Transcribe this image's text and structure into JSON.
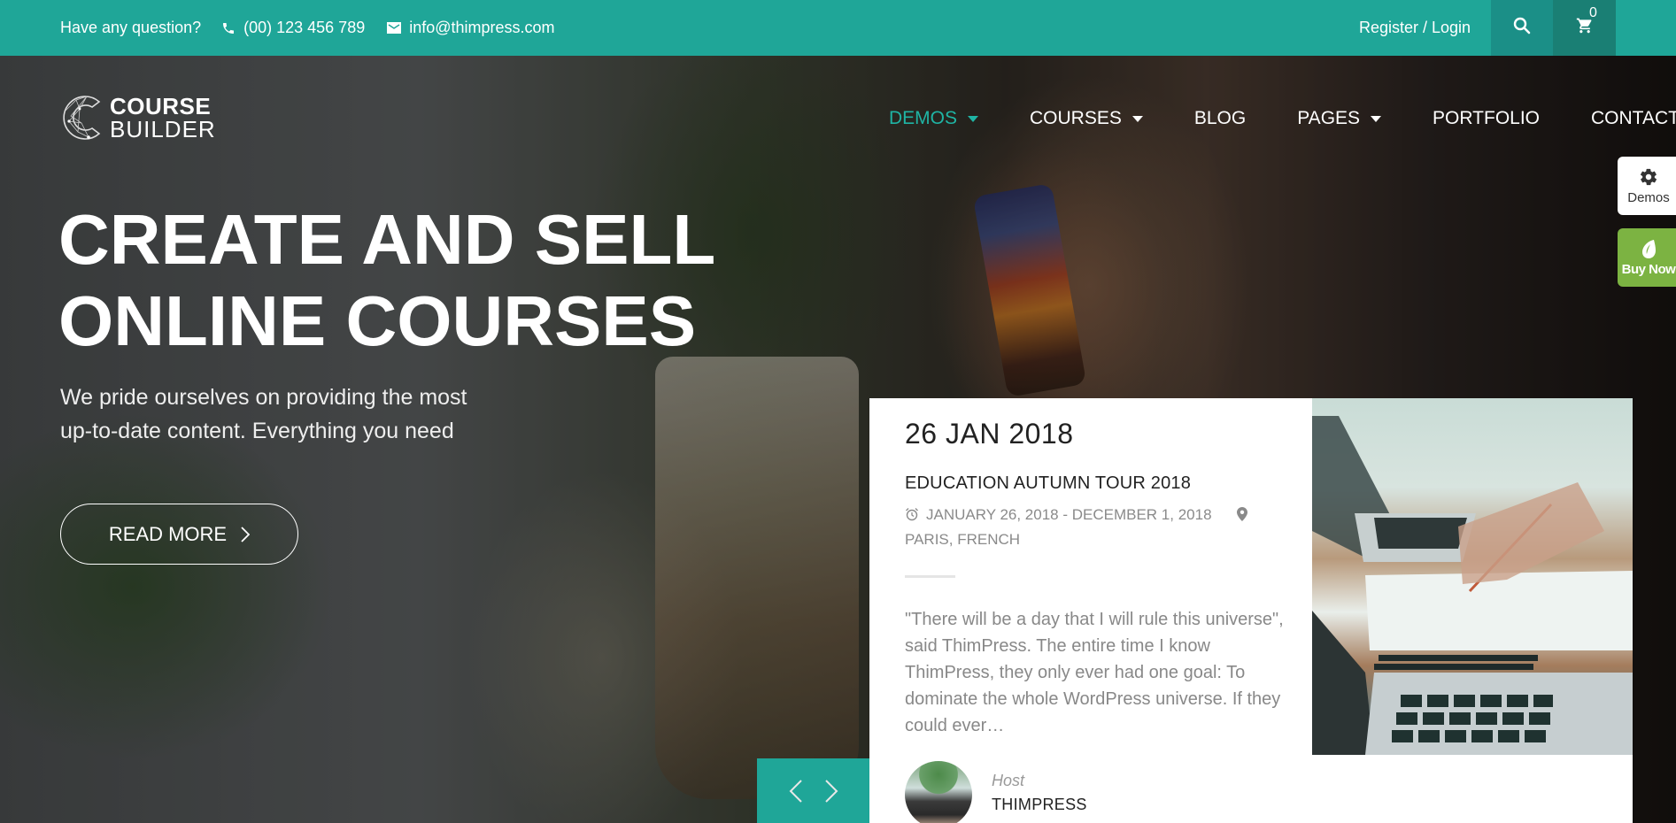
{
  "topbar": {
    "question": "Have any question?",
    "phone": "(00) 123 456 789",
    "email": "info@thimpress.com",
    "register_login": "Register / Login",
    "cart_count": "0",
    "color": "#1fa698"
  },
  "logo": {
    "line1": "COURSE",
    "line2": "BUILDER"
  },
  "nav": {
    "items": [
      {
        "label": "DEMOS",
        "has_dropdown": true,
        "active": true
      },
      {
        "label": "COURSES",
        "has_dropdown": true,
        "active": false
      },
      {
        "label": "BLOG",
        "has_dropdown": false,
        "active": false
      },
      {
        "label": "PAGES",
        "has_dropdown": true,
        "active": false
      },
      {
        "label": "PORTFOLIO",
        "has_dropdown": false,
        "active": false
      },
      {
        "label": "CONTACT",
        "has_dropdown": false,
        "active": false
      }
    ],
    "active_color": "#1fb4a4"
  },
  "side_tabs": {
    "demos_label": "Demos",
    "buy_label": "Buy Now",
    "buy_color": "#7cb342"
  },
  "hero": {
    "title_line1": "CREATE AND SELL",
    "title_line2": "ONLINE COURSES",
    "desc_line1": "We pride ourselves on providing the most",
    "desc_line2": "up-to-date content. Everything you need",
    "button_label": "READ MORE"
  },
  "event": {
    "date": "26 JAN 2018",
    "title": "EDUCATION AUTUMN TOUR 2018",
    "date_range": "JANUARY 26, 2018 - DECEMBER 1, 2018",
    "location": "PARIS, FRENCH",
    "excerpt": "\"There will be a day that I will rule this universe\", said ThimPress. The entire time I know ThimPress, they only ever had one goal: To dominate the whole WordPress universe. If they could ever…",
    "host_label": "Host",
    "host_name": "THIMPRESS"
  },
  "icons": {
    "phone": "phone-icon",
    "email": "envelope-icon",
    "search": "search-icon",
    "cart": "cart-icon",
    "gear": "gear-icon",
    "leaf": "envato-leaf-icon",
    "clock": "alarm-clock-icon",
    "location": "map-pin-icon",
    "prev": "chevron-left-icon",
    "next": "chevron-right-icon"
  }
}
